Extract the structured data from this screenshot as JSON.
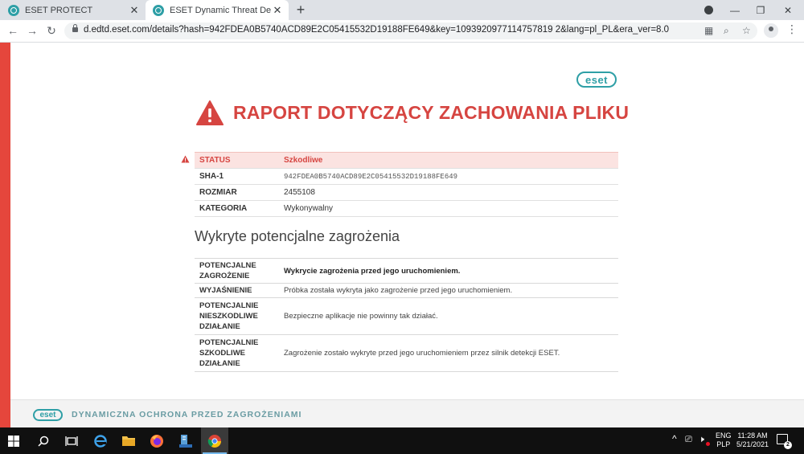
{
  "browser": {
    "tabs": [
      {
        "title": "ESET PROTECT",
        "active": false
      },
      {
        "title": "ESET Dynamic Threat Defence –",
        "active": true
      }
    ],
    "url": "d.edtd.eset.com/details?hash=942FDEA0B5740ACD89E2C05415532D19188FE649&key=1093920977114757819 2&lang=pl_PL&era_ver=8.0"
  },
  "logo_text": "eset",
  "report": {
    "title": "RAPORT DOTYCZĄCY ZACHOWANIA PLIKU",
    "info": [
      {
        "label": "STATUS",
        "value": "Szkodliwe"
      },
      {
        "label": "SHA-1",
        "value": "942FDEA0B5740ACD89E2C05415532D19188FE649"
      },
      {
        "label": "ROZMIAR",
        "value": "2455108"
      },
      {
        "label": "KATEGORIA",
        "value": "Wykonywalny"
      }
    ],
    "section_title": "Wykryte potencjalne zagrożenia",
    "threats": [
      {
        "label": "POTENCJALNE ZAGROŻENIE",
        "value": "Wykrycie zagrożenia przed jego uruchomieniem."
      },
      {
        "label": "WYJAŚNIENIE",
        "value": "Próbka została wykryta jako zagrożenie przed jego uruchomieniem."
      },
      {
        "label": "POTENCJALNIE NIESZKODLIWE DZIAŁANIE",
        "value": "Bezpieczne aplikacje nie powinny tak działać."
      },
      {
        "label": "POTENCJALNIE SZKODLIWE DZIAŁANIE",
        "value": "Zagrożenie zostało wykryte przed jego uruchomieniem przez silnik detekcji ESET."
      }
    ]
  },
  "footer": {
    "text": "DYNAMICZNA OCHRONA PRZED ZAGROŻENIAMI"
  },
  "taskbar": {
    "lang": "ENG",
    "layout": "PLP",
    "time": "11:28 AM",
    "date": "5/21/2021",
    "notification_count": "2"
  },
  "colors": {
    "accent": "#2e9fa6",
    "danger": "#d64541",
    "sidebar": "#e5463c"
  }
}
